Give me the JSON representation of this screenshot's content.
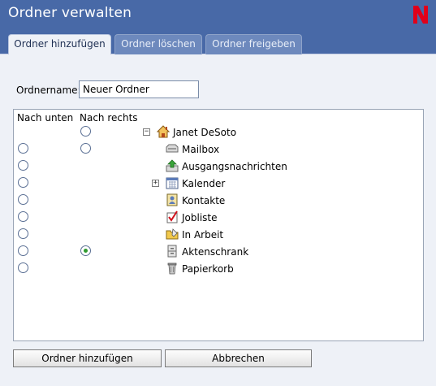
{
  "window": {
    "title": "Ordner verwalten",
    "logo_letter": "N"
  },
  "tabs": [
    {
      "label": "Ordner hinzufügen",
      "active": true
    },
    {
      "label": "Ordner löschen",
      "active": false
    },
    {
      "label": "Ordner freigeben",
      "active": false
    }
  ],
  "form": {
    "name_label": "Ordnername:",
    "name_value": "Neuer Ordner"
  },
  "tree": {
    "col_below": "Nach unten",
    "col_right": "Nach rechts",
    "rows": [
      {
        "label": "Janet DeSoto",
        "icon": "home-icon",
        "expander": "−",
        "radio_below": false,
        "radio_right": true,
        "checked_right": false
      },
      {
        "label": "Mailbox",
        "icon": "mailbox-icon",
        "expander": "",
        "radio_below": true,
        "radio_right": true,
        "checked_right": false
      },
      {
        "label": "Ausgangsnachrichten",
        "icon": "outbox-icon",
        "expander": "",
        "radio_below": true,
        "radio_right": false,
        "checked_right": false
      },
      {
        "label": "Kalender",
        "icon": "calendar-icon",
        "expander": "+",
        "radio_below": true,
        "radio_right": false,
        "checked_right": false
      },
      {
        "label": "Kontakte",
        "icon": "contacts-icon",
        "expander": "",
        "radio_below": true,
        "radio_right": false,
        "checked_right": false
      },
      {
        "label": "Jobliste",
        "icon": "checklist-icon",
        "expander": "",
        "radio_below": true,
        "radio_right": false,
        "checked_right": false
      },
      {
        "label": "In Arbeit",
        "icon": "work-in-progress-icon",
        "expander": "",
        "radio_below": true,
        "radio_right": false,
        "checked_right": false
      },
      {
        "label": "Aktenschrank",
        "icon": "cabinet-icon",
        "expander": "",
        "radio_below": true,
        "radio_right": true,
        "checked_right": true
      },
      {
        "label": "Papierkorb",
        "icon": "trash-icon",
        "expander": "",
        "radio_below": true,
        "radio_right": false,
        "checked_right": false
      }
    ]
  },
  "buttons": {
    "add": "Ordner hinzufügen",
    "cancel": "Abbrechen"
  },
  "colors": {
    "header": "#4869a7",
    "panel": "#eef1f7",
    "logo": "#e1001a",
    "selected_radio": "#2f9a2f"
  }
}
